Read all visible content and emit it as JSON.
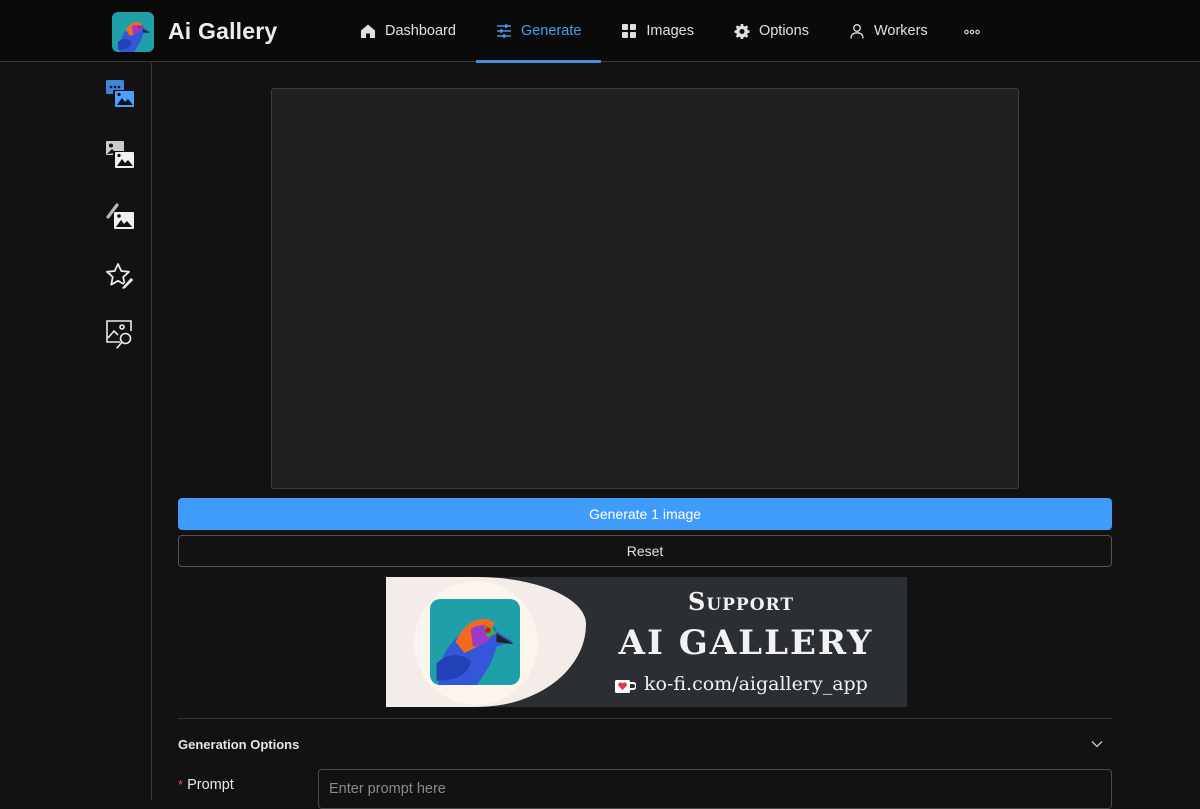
{
  "app": {
    "title": "Ai Gallery",
    "accent_color": "#409cfa"
  },
  "nav": {
    "items": [
      {
        "label": "Dashboard",
        "icon": "home-icon",
        "active": false
      },
      {
        "label": "Generate",
        "icon": "sliders-icon",
        "active": true
      },
      {
        "label": "Images",
        "icon": "grid-icon",
        "active": false
      },
      {
        "label": "Options",
        "icon": "gear-icon",
        "active": false
      },
      {
        "label": "Workers",
        "icon": "user-icon",
        "active": false
      }
    ],
    "more_icon": "ellipsis-icon"
  },
  "sidebar": {
    "items": [
      {
        "name": "text-to-image",
        "icon": "text-to-image-icon",
        "active": true
      },
      {
        "name": "image-to-image",
        "icon": "image-to-image-icon",
        "active": false
      },
      {
        "name": "inpainting",
        "icon": "inpaint-icon",
        "active": false
      },
      {
        "name": "style-edit",
        "icon": "star-edit-icon",
        "active": false
      },
      {
        "name": "image-search",
        "icon": "image-search-icon",
        "active": false
      }
    ]
  },
  "main": {
    "generate_label": "Generate 1 image",
    "reset_label": "Reset",
    "banner": {
      "support_text": "Support",
      "title_text": "AI GALLERY",
      "link_text": "ko-fi.com/aigallery_app"
    },
    "generation_options": {
      "title": "Generation Options",
      "prompt_label": "Prompt",
      "prompt_required_marker": "*",
      "prompt_value": "",
      "prompt_placeholder": "Enter prompt here"
    }
  }
}
